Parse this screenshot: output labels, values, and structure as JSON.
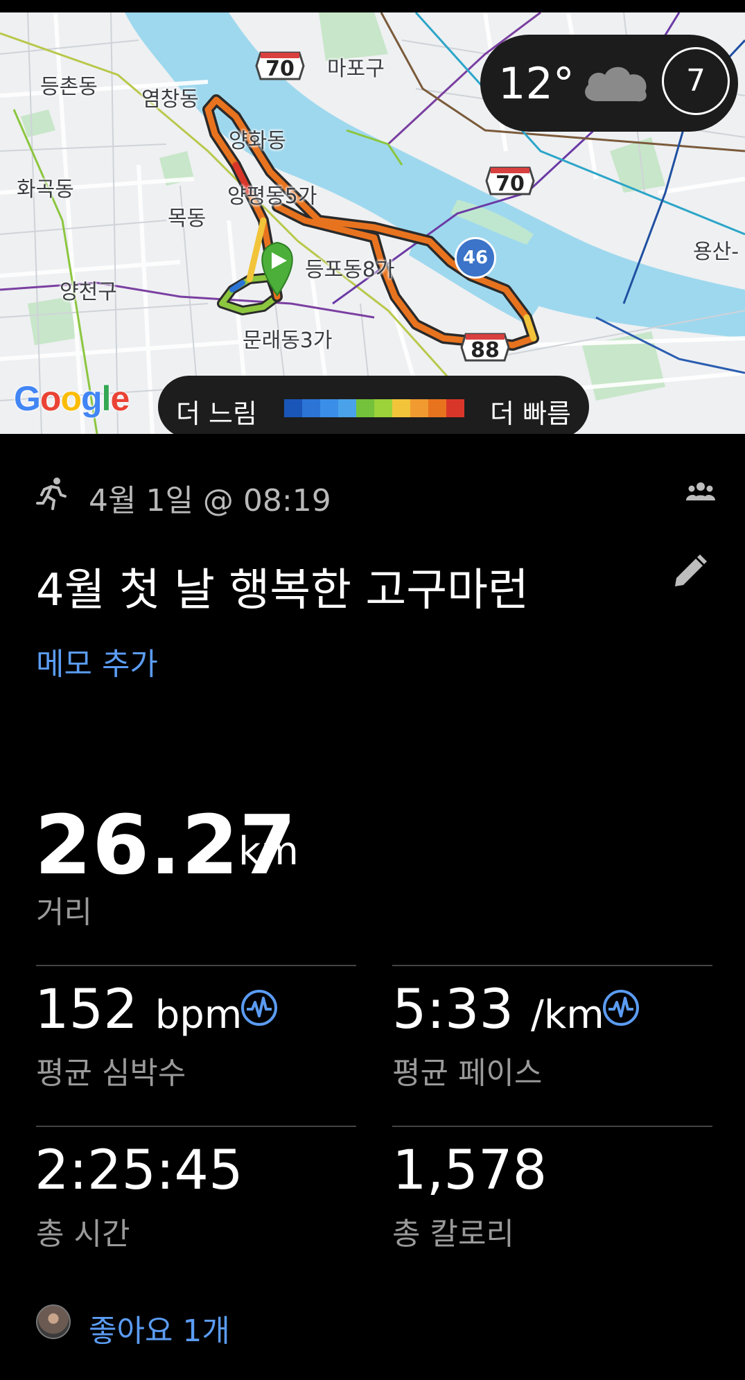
{
  "map": {
    "labels": {
      "deungchon": "등촌동",
      "yeomchang": "염창동",
      "mapo": "마포구",
      "yanghwa": "양화동",
      "hwagok": "화곡동",
      "mok": "목동",
      "yangpyeong": "양평동5가",
      "dangsan": "등포동8가",
      "yangcheon": "양천구",
      "mullae": "문래동3가",
      "yongsan": "용산-"
    },
    "shields": [
      "70",
      "70",
      "88"
    ],
    "badge": "46",
    "google": "Google",
    "route_color": "#e8731f"
  },
  "weather": {
    "temperature": "12°",
    "icon": "cloud-icon",
    "badge": "7"
  },
  "speed_legend": {
    "slow": "더 느림",
    "fast": "더 빠름",
    "colors": [
      "#1a56b8",
      "#2c74d6",
      "#3b8ee8",
      "#4aa3ea",
      "#74c23b",
      "#9cd23a",
      "#f2c43a",
      "#f19a30",
      "#e8731f",
      "#d9362a"
    ]
  },
  "activity": {
    "date": "4월 1일 @ 08:19",
    "title": "4월 첫 날 행복한 고구마런",
    "memo": "메모 추가",
    "distance_value": "26.27",
    "distance_unit": "km",
    "distance_label": "거리",
    "stats": {
      "heart_rate_value": "152",
      "heart_rate_unit": "bpm",
      "heart_rate_label": "평균 심박수",
      "pace_value": "5:33",
      "pace_unit": "/km",
      "pace_label": "평균 페이스",
      "time_value": "2:25:45",
      "time_label": "총 시간",
      "calories_value": "1,578",
      "calories_label": "총 칼로리"
    },
    "likes": "좋아요 1개"
  },
  "colors": {
    "accent": "#5b9cf3",
    "muted": "#9a9a9a",
    "background": "#000000"
  }
}
